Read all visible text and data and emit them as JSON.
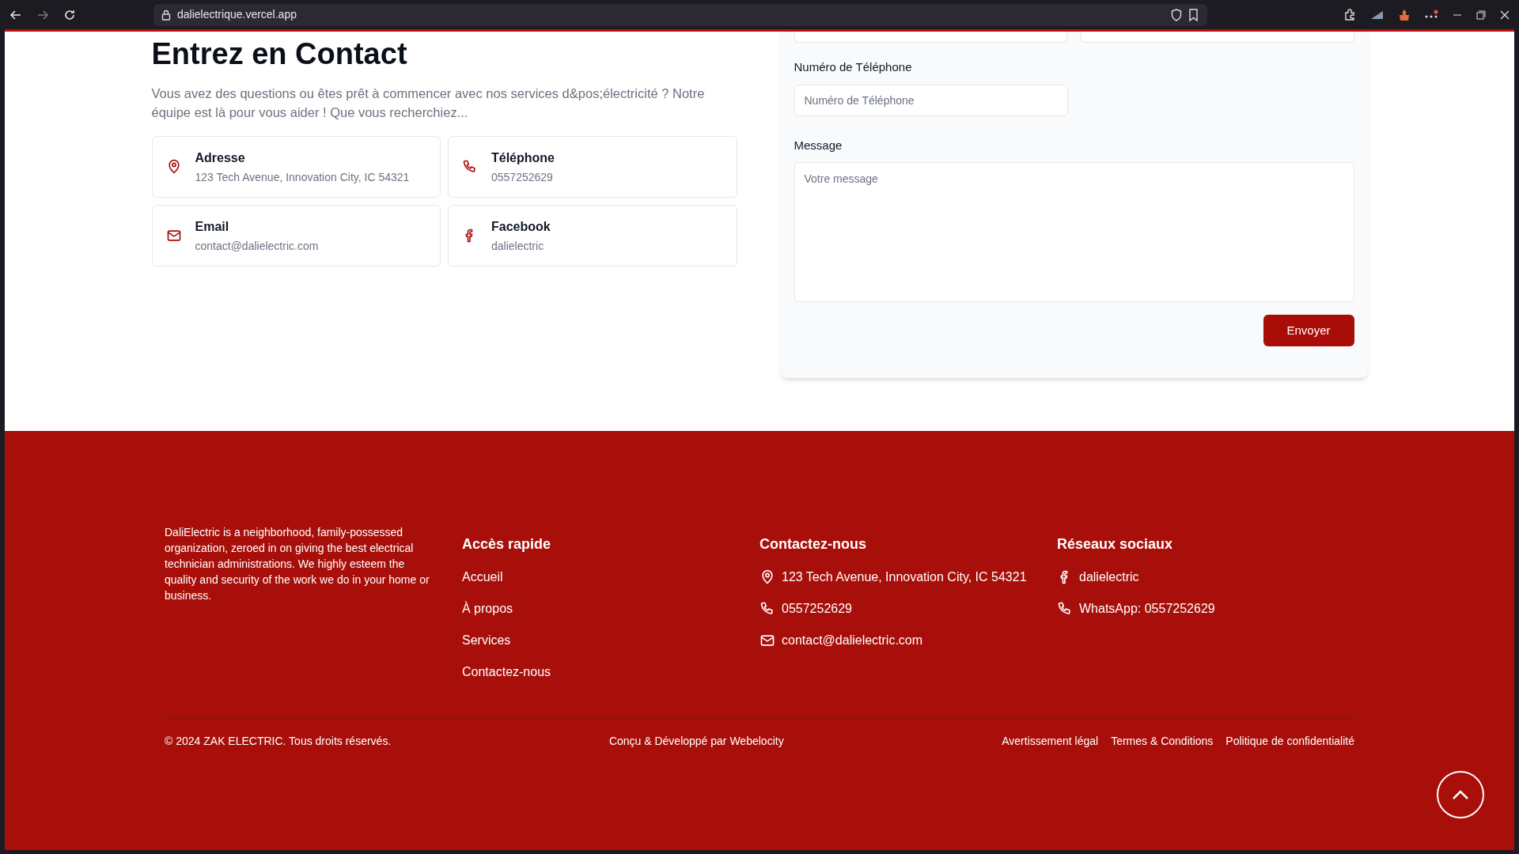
{
  "browser": {
    "url": "dalielectrique.vercel.app",
    "back_disabled": false,
    "forward_disabled": true
  },
  "contact": {
    "title": "Entrez en Contact",
    "intro": "Vous avez des questions ou êtes prêt à commencer avec nos services d&pos;électricité ? Notre équipe est là pour vous aider ! Que vous recherchiez...",
    "cards": [
      {
        "kind": "pin",
        "title": "Adresse",
        "value": "123 Tech Avenue, Innovation City, IC 54321"
      },
      {
        "kind": "phone",
        "title": "Téléphone",
        "value": "0557252629"
      },
      {
        "kind": "mail",
        "title": "Email",
        "value": "contact@dalielectric.com"
      },
      {
        "kind": "facebook",
        "title": "Facebook",
        "value": "dalielectric"
      }
    ]
  },
  "form": {
    "phone_label": "Numéro de Téléphone",
    "phone_placeholder": "Numéro de Téléphone",
    "message_label": "Message",
    "message_placeholder": "Votre message",
    "submit": "Envoyer"
  },
  "footer": {
    "about": "DaliElectric is a neighborhood, family-possessed organization, zeroed in on giving the best electrical technician administrations. We highly esteem the quality and security of the work we do in your home or business.",
    "quick_title": "Accès rapide",
    "quick_links": [
      "Accueil",
      "À propos",
      "Services",
      "Contactez-nous"
    ],
    "contact_title": "Contactez-nous",
    "contact_items": [
      {
        "kind": "pin",
        "text": "123 Tech Avenue, Innovation City, IC 54321"
      },
      {
        "kind": "phone",
        "text": "0557252629"
      },
      {
        "kind": "mail",
        "text": "contact@dalielectric.com"
      }
    ],
    "social_title": "Réseaux sociaux",
    "social_items": [
      {
        "kind": "facebook",
        "text": "dalielectric"
      },
      {
        "kind": "phone",
        "text": "WhatsApp: 0557252629"
      }
    ],
    "copyright": "© 2024 ZAK ELECTRIC. Tous droits réservés.",
    "credit": "Conçu & Développé par Webelocity",
    "legal_links": [
      "Avertissement légal",
      "Termes & Conditions",
      "Politique de confidentialité"
    ]
  }
}
